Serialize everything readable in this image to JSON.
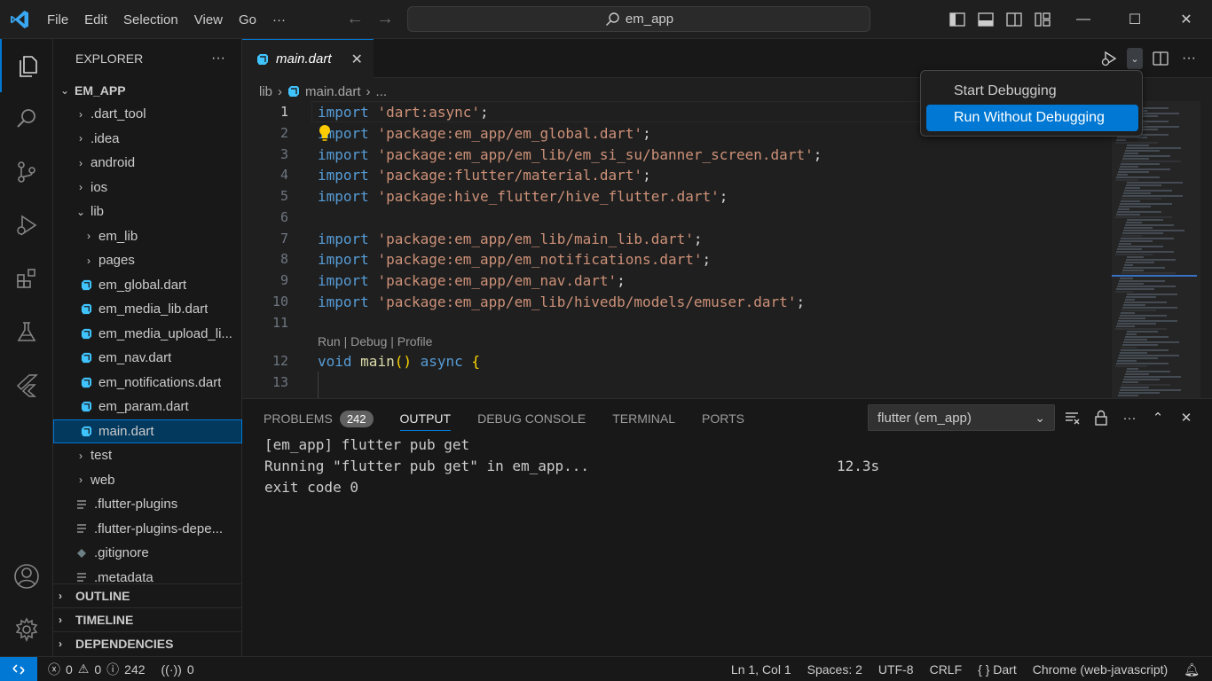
{
  "menu": [
    "File",
    "Edit",
    "Selection",
    "View",
    "Go",
    "···"
  ],
  "command_center": {
    "text": "em_app"
  },
  "window_controls": {
    "minimize": "—",
    "maximize": "☐",
    "close": "✕"
  },
  "explorer": {
    "title": "EXPLORER",
    "more": "···",
    "root": "EM_APP",
    "items": [
      {
        "label": ".dart_tool",
        "kind": "folder",
        "depth": 1,
        "open": false
      },
      {
        "label": ".idea",
        "kind": "folder",
        "depth": 1,
        "open": false
      },
      {
        "label": "android",
        "kind": "folder",
        "depth": 1,
        "open": false
      },
      {
        "label": "ios",
        "kind": "folder",
        "depth": 1,
        "open": false
      },
      {
        "label": "lib",
        "kind": "folder",
        "depth": 1,
        "open": true
      },
      {
        "label": "em_lib",
        "kind": "folder",
        "depth": 2,
        "open": false
      },
      {
        "label": "pages",
        "kind": "folder",
        "depth": 2,
        "open": false
      },
      {
        "label": "em_global.dart",
        "kind": "dart",
        "depth": 2
      },
      {
        "label": "em_media_lib.dart",
        "kind": "dart",
        "depth": 2
      },
      {
        "label": "em_media_upload_li...",
        "kind": "dart",
        "depth": 2
      },
      {
        "label": "em_nav.dart",
        "kind": "dart",
        "depth": 2
      },
      {
        "label": "em_notifications.dart",
        "kind": "dart",
        "depth": 2
      },
      {
        "label": "em_param.dart",
        "kind": "dart",
        "depth": 2
      },
      {
        "label": "main.dart",
        "kind": "dart",
        "depth": 2,
        "selected": true
      },
      {
        "label": "test",
        "kind": "folder",
        "depth": 1,
        "open": false
      },
      {
        "label": "web",
        "kind": "folder",
        "depth": 1,
        "open": false
      },
      {
        "label": ".flutter-plugins",
        "kind": "text",
        "depth": 1
      },
      {
        "label": ".flutter-plugins-depe...",
        "kind": "text",
        "depth": 1
      },
      {
        "label": ".gitignore",
        "kind": "git",
        "depth": 1
      },
      {
        "label": ".metadata",
        "kind": "text",
        "depth": 1
      }
    ],
    "sections": [
      "OUTLINE",
      "TIMELINE",
      "DEPENDENCIES"
    ]
  },
  "tab": {
    "name": "main.dart",
    "close": "✕"
  },
  "breadcrumb": {
    "folder": "lib",
    "file": "main.dart",
    "more": "..."
  },
  "editor": {
    "lines": [
      {
        "n": "1",
        "tokens": [
          [
            "kw",
            "import"
          ],
          [
            "plain",
            " "
          ],
          [
            "str",
            "'dart:async'"
          ],
          [
            "plain",
            ";"
          ]
        ]
      },
      {
        "n": "2",
        "tokens": [
          [
            "kw",
            "import"
          ],
          [
            "plain",
            " "
          ],
          [
            "str",
            "'package:em_app/em_global.dart'"
          ],
          [
            "plain",
            ";"
          ]
        ]
      },
      {
        "n": "3",
        "tokens": [
          [
            "kw",
            "import"
          ],
          [
            "plain",
            " "
          ],
          [
            "str",
            "'package:em_app/em_lib/em_si_su/banner_screen.dart'"
          ],
          [
            "plain",
            ";"
          ]
        ]
      },
      {
        "n": "4",
        "tokens": [
          [
            "kw",
            "import"
          ],
          [
            "plain",
            " "
          ],
          [
            "str",
            "'package:flutter/material.dart'"
          ],
          [
            "plain",
            ";"
          ]
        ]
      },
      {
        "n": "5",
        "tokens": [
          [
            "kw",
            "import"
          ],
          [
            "plain",
            " "
          ],
          [
            "str",
            "'package:hive_flutter/hive_flutter.dart'"
          ],
          [
            "plain",
            ";"
          ]
        ]
      },
      {
        "n": "6",
        "tokens": []
      },
      {
        "n": "7",
        "tokens": [
          [
            "kw",
            "import"
          ],
          [
            "plain",
            " "
          ],
          [
            "str",
            "'package:em_app/em_lib/main_lib.dart'"
          ],
          [
            "plain",
            ";"
          ]
        ]
      },
      {
        "n": "8",
        "tokens": [
          [
            "kw",
            "import"
          ],
          [
            "plain",
            " "
          ],
          [
            "str",
            "'package:em_app/em_notifications.dart'"
          ],
          [
            "plain",
            ";"
          ]
        ]
      },
      {
        "n": "9",
        "tokens": [
          [
            "kw",
            "import"
          ],
          [
            "plain",
            " "
          ],
          [
            "str",
            "'package:em_app/em_nav.dart'"
          ],
          [
            "plain",
            ";"
          ]
        ]
      },
      {
        "n": "10",
        "tokens": [
          [
            "kw",
            "import"
          ],
          [
            "plain",
            " "
          ],
          [
            "str",
            "'package:em_app/em_lib/hivedb/models/emuser.dart'"
          ],
          [
            "plain",
            ";"
          ]
        ]
      },
      {
        "n": "11",
        "tokens": []
      },
      {
        "n": "12",
        "tokens": [
          [
            "kw",
            "void"
          ],
          [
            "plain",
            " "
          ],
          [
            "fn",
            "main"
          ],
          [
            "br",
            "()"
          ],
          [
            "plain",
            " "
          ],
          [
            "kw",
            "async"
          ],
          [
            "plain",
            " "
          ],
          [
            "br",
            "{"
          ]
        ]
      },
      {
        "n": "13",
        "tokens": []
      }
    ],
    "codelens": "Run | Debug | Profile"
  },
  "debug_menu": {
    "items": [
      "Start Debugging",
      "Run Without Debugging"
    ]
  },
  "panel": {
    "tabs": [
      "PROBLEMS",
      "OUTPUT",
      "DEBUG CONSOLE",
      "TERMINAL",
      "PORTS"
    ],
    "problems_count": "242",
    "channel": "flutter (em_app)",
    "output": [
      {
        "text": "[em_app] flutter pub get",
        "time": ""
      },
      {
        "text": "Running \"flutter pub get\" in em_app...",
        "time": "12.3s"
      },
      {
        "text": "exit code 0",
        "time": ""
      }
    ]
  },
  "status": {
    "errors": "0",
    "warnings": "0",
    "infos": "242",
    "ports": "0",
    "position": "Ln 1, Col 1",
    "spaces": "Spaces: 2",
    "encoding": "UTF-8",
    "eol": "CRLF",
    "language": "Dart",
    "device": "Chrome (web-javascript)"
  },
  "colors": {
    "accent": "#0078d4",
    "keyword": "#569cd6",
    "string": "#ce9178",
    "function": "#dcdcaa",
    "dart": "#40c4ff"
  }
}
